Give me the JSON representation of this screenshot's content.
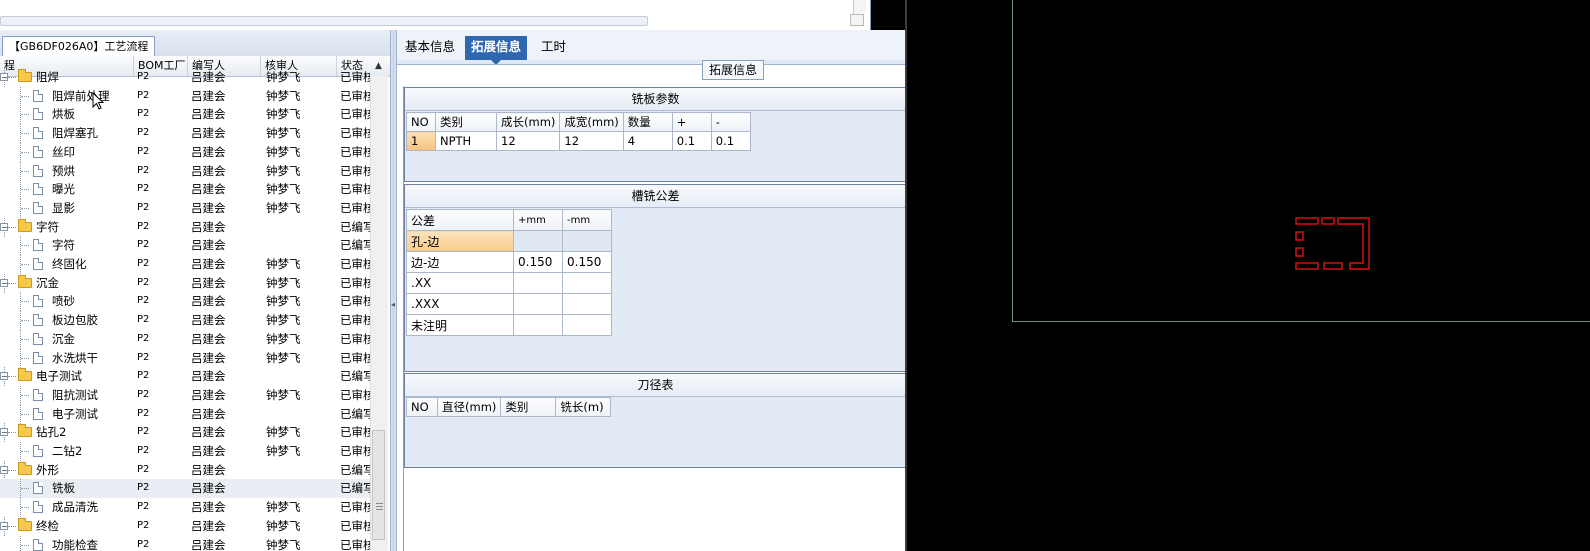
{
  "left": {
    "process_tab": "【GB6DF026A0】工艺流程",
    "columns": [
      "程",
      "BOM工厂",
      "编写人",
      "核审人",
      "状态"
    ],
    "rows": [
      {
        "level": 0,
        "kind": "folder",
        "name": "阻焊",
        "bom": "P2",
        "writer": "吕建会",
        "reviewer": "钟梦飞",
        "status": "已审核",
        "partial": true
      },
      {
        "level": 1,
        "kind": "doc",
        "name": "阻焊前处理",
        "bom": "P2",
        "writer": "吕建会",
        "reviewer": "钟梦飞",
        "status": "已审核"
      },
      {
        "level": 1,
        "kind": "doc",
        "name": "烘板",
        "bom": "P2",
        "writer": "吕建会",
        "reviewer": "钟梦飞",
        "status": "已审核"
      },
      {
        "level": 1,
        "kind": "doc",
        "name": "阻焊塞孔",
        "bom": "P2",
        "writer": "吕建会",
        "reviewer": "钟梦飞",
        "status": "已审核"
      },
      {
        "level": 1,
        "kind": "doc",
        "name": "丝印",
        "bom": "P2",
        "writer": "吕建会",
        "reviewer": "钟梦飞",
        "status": "已审核"
      },
      {
        "level": 1,
        "kind": "doc",
        "name": "预烘",
        "bom": "P2",
        "writer": "吕建会",
        "reviewer": "钟梦飞",
        "status": "已审核"
      },
      {
        "level": 1,
        "kind": "doc",
        "name": "曝光",
        "bom": "P2",
        "writer": "吕建会",
        "reviewer": "钟梦飞",
        "status": "已审核"
      },
      {
        "level": 1,
        "kind": "doc",
        "name": "显影",
        "bom": "P2",
        "writer": "吕建会",
        "reviewer": "钟梦飞",
        "status": "已审核"
      },
      {
        "level": 0,
        "kind": "folder",
        "name": "字符",
        "bom": "P2",
        "writer": "吕建会",
        "reviewer": "",
        "status": "已编写"
      },
      {
        "level": 1,
        "kind": "doc",
        "name": "字符",
        "bom": "P2",
        "writer": "吕建会",
        "reviewer": "",
        "status": "已编写"
      },
      {
        "level": 1,
        "kind": "doc",
        "name": "终固化",
        "bom": "P2",
        "writer": "吕建会",
        "reviewer": "钟梦飞",
        "status": "已审核"
      },
      {
        "level": 0,
        "kind": "folder",
        "name": "沉金",
        "bom": "P2",
        "writer": "吕建会",
        "reviewer": "钟梦飞",
        "status": "已审核"
      },
      {
        "level": 1,
        "kind": "doc",
        "name": "喷砂",
        "bom": "P2",
        "writer": "吕建会",
        "reviewer": "钟梦飞",
        "status": "已审核"
      },
      {
        "level": 1,
        "kind": "doc",
        "name": "板边包胶",
        "bom": "P2",
        "writer": "吕建会",
        "reviewer": "钟梦飞",
        "status": "已审核"
      },
      {
        "level": 1,
        "kind": "doc",
        "name": "沉金",
        "bom": "P2",
        "writer": "吕建会",
        "reviewer": "钟梦飞",
        "status": "已审核"
      },
      {
        "level": 1,
        "kind": "doc",
        "name": "水洗烘干",
        "bom": "P2",
        "writer": "吕建会",
        "reviewer": "钟梦飞",
        "status": "已审核"
      },
      {
        "level": 0,
        "kind": "folder",
        "name": "电子测试",
        "bom": "P2",
        "writer": "吕建会",
        "reviewer": "",
        "status": "已编写"
      },
      {
        "level": 1,
        "kind": "doc",
        "name": "阻抗测试",
        "bom": "P2",
        "writer": "吕建会",
        "reviewer": "钟梦飞",
        "status": "已审核"
      },
      {
        "level": 1,
        "kind": "doc",
        "name": "电子测试",
        "bom": "P2",
        "writer": "吕建会",
        "reviewer": "",
        "status": "已编写"
      },
      {
        "level": 0,
        "kind": "folder",
        "name": "钻孔2",
        "bom": "P2",
        "writer": "吕建会",
        "reviewer": "钟梦飞",
        "status": "已审核"
      },
      {
        "level": 1,
        "kind": "doc",
        "name": "二钻2",
        "bom": "P2",
        "writer": "吕建会",
        "reviewer": "钟梦飞",
        "status": "已审核"
      },
      {
        "level": 0,
        "kind": "folder",
        "name": "外形",
        "bom": "P2",
        "writer": "吕建会",
        "reviewer": "",
        "status": "已编写"
      },
      {
        "level": 1,
        "kind": "doc",
        "name": "铣板",
        "bom": "P2",
        "writer": "吕建会",
        "reviewer": "",
        "status": "已编写",
        "selected": true
      },
      {
        "level": 1,
        "kind": "doc",
        "name": "成品清洗",
        "bom": "P2",
        "writer": "吕建会",
        "reviewer": "钟梦飞",
        "status": "已审核"
      },
      {
        "level": 0,
        "kind": "folder",
        "name": "终检",
        "bom": "P2",
        "writer": "吕建会",
        "reviewer": "钟梦飞",
        "status": "已审核"
      },
      {
        "level": 1,
        "kind": "doc",
        "name": "功能检查",
        "bom": "P2",
        "writer": "吕建会",
        "reviewer": "钟梦飞",
        "status": "已审核",
        "partial": true
      }
    ]
  },
  "right": {
    "tabs": [
      "基本信息",
      "拓展信息",
      "工时"
    ],
    "active_tab": "拓展信息",
    "group_label": "拓展信息",
    "mill_params": {
      "title": "铣板参数",
      "headers": [
        "NO",
        "类别",
        "成长(mm)",
        "成宽(mm)",
        "数量",
        "+",
        "-"
      ],
      "rows": [
        [
          "1",
          "NPTH",
          "12",
          "12",
          "4",
          "0.1",
          "0.1"
        ]
      ]
    },
    "slot_tolerance": {
      "title": "槽铣公差",
      "headers": [
        "公差",
        "+mm",
        "-mm"
      ],
      "rows": [
        [
          "孔-边",
          "",
          ""
        ],
        [
          "边-边",
          "0.150",
          "0.150"
        ],
        [
          ".XX",
          "",
          ""
        ],
        [
          ".XXX",
          "",
          ""
        ],
        [
          "未注明",
          "",
          ""
        ]
      ]
    },
    "tool_table": {
      "title": "刀径表",
      "headers": [
        "NO",
        "直径(mm)",
        "类别",
        "铣长(m)"
      ]
    }
  },
  "colors": {
    "accent_tab": "#2f67b1",
    "row_header_orange": "#f6c47c",
    "cad_red": "#e01010",
    "viewer_bg": "#000000"
  }
}
